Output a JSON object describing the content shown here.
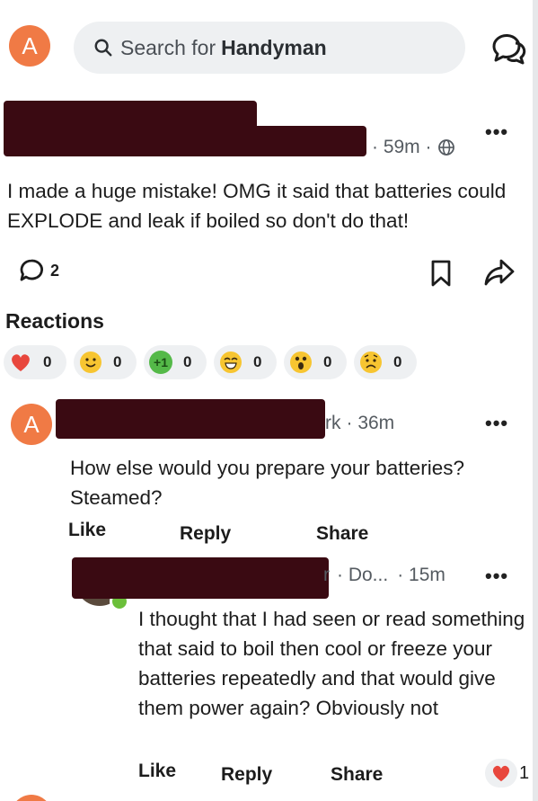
{
  "header": {
    "avatar_letter": "A",
    "search_prefix": "Search for",
    "search_group": "Handyman",
    "chat_icon": "chat-bubbles-icon"
  },
  "post": {
    "time": "· 59m ·",
    "visibility_icon": "globe-icon",
    "text": "I made a huge mistake! OMG it said that batteries could EXPLODE and leak if boiled so don't do that!",
    "comment_count": "2",
    "more_label": "•••"
  },
  "reactions": {
    "title": "Reactions",
    "items": [
      {
        "name": "heart",
        "count": "0",
        "color": "#e8473d"
      },
      {
        "name": "smile",
        "count": "0",
        "color": "#f7c531"
      },
      {
        "name": "plus-one",
        "label": "+1",
        "count": "0",
        "color": "#54b948"
      },
      {
        "name": "grin",
        "count": "0",
        "color": "#f7c531"
      },
      {
        "name": "wow",
        "count": "0",
        "color": "#f7c531"
      },
      {
        "name": "sad",
        "count": "0",
        "color": "#f7c531"
      }
    ]
  },
  "comment": {
    "avatar_letter": "A",
    "name_fragment": "rk",
    "time": "· 36m",
    "more_label": "•••",
    "text": "How else would you prepare your batteries? Steamed?",
    "like": "Like",
    "reply": "Reply",
    "share": "Share"
  },
  "reply": {
    "name_fragment": "r",
    "sub": "· Do...",
    "time": "· 15m",
    "more_label": "•••",
    "text": "I thought that I had seen or read something that said to boil then cool or freeze your batteries repeatedly and that would give them power again? Obviously not",
    "like": "Like",
    "reply": "Reply",
    "share": "Share",
    "heart_count": "1"
  },
  "colors": {
    "accent_orange": "#f07a45",
    "redaction": "#3a0a12",
    "pill_bg": "#eef0f2"
  }
}
